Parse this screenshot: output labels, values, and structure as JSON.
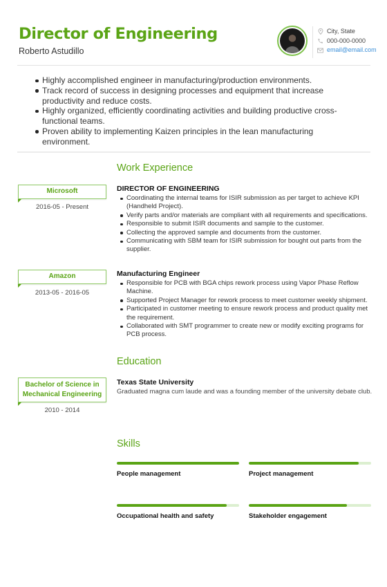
{
  "header": {
    "title": "Director of Engineering",
    "name": "Roberto Astudillo"
  },
  "contact": {
    "location": "City, State",
    "phone": "000-000-0000",
    "email": "email@email.com"
  },
  "summary": [
    "Highly accomplished engineer in manufacturing/production environments.",
    "Track record of success in designing processes and equipment that increase productivity and reduce costs.",
    "Highly organized, efficiently coordinating activities and building productive cross-functional teams.",
    "Proven ability to implementing Kaizen principles in the lean manufacturing environment."
  ],
  "work_experience": {
    "title": "Work Experience",
    "jobs": [
      {
        "company": "Microsoft",
        "dates": "2016-05 - Present",
        "role": "DIRECTOR OF ENGINEERING",
        "bullets": [
          "Coordinating the internal teams for ISIR submission as per target to achieve KPI (Handheld Project).",
          "Verify parts and/or materials are compliant with all requirements and specifications.",
          "Responsible to submit ISIR documents and sample to the customer.",
          "Collecting the approved sample and documents from the customer.",
          "Communicating with SBM team for ISIR submission for bought out parts from the supplier."
        ]
      },
      {
        "company": "Amazon",
        "dates": "2013-05 - 2016-05",
        "role": "Manufacturing Engineer",
        "bullets": [
          "Responsible for PCB with BGA chips rework process using Vapor Phase Reflow Machine.",
          "Supported Project Manager for rework process to meet customer weekly shipment.",
          "Participated in customer meeting to ensure rework process and product quality met the requirement.",
          "Collaborated with SMT programmer to create new or modify exciting programs for PCB process."
        ]
      }
    ]
  },
  "education": {
    "title": "Education",
    "degree": "Bachelor of Science in Mechanical Engineering",
    "dates": "2010 - 2014",
    "school": "Texas State University",
    "description": "Graduated magna cum laude and was a founding member of the university debate club."
  },
  "skills": {
    "title": "Skills",
    "items": [
      {
        "label": "People management",
        "level": 1.0
      },
      {
        "label": "Project management",
        "level": 0.9
      },
      {
        "label": "Occupational health and safety",
        "level": 0.9
      },
      {
        "label": "Stakeholder engagement",
        "level": 0.8
      }
    ]
  },
  "colors": {
    "accent": "#5aa415",
    "bar_track": "#dcefd0",
    "link": "#3b8fd8"
  }
}
